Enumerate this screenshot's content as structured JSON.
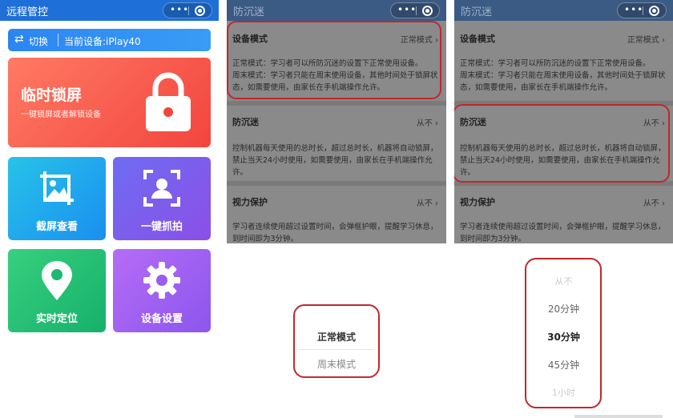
{
  "p1": {
    "title": "远程管控",
    "switch_label": "切换",
    "device": "当前设备:iPlay40",
    "lock": {
      "title": "临时锁屏",
      "subtitle": "一键锁屏或者解锁设备"
    },
    "tiles": [
      "截屏查看",
      "一键抓拍",
      "实时定位",
      "设备设置"
    ]
  },
  "p2": {
    "title": "防沉迷",
    "mode": {
      "title": "设备模式",
      "value": "正常模式",
      "desc1": "正常模式：学习者可以所防沉迷的设置下正常使用设备。",
      "desc2": "周末模式：学习者只能在周末使用设备，其他时间处于锁屏状",
      "desc3": "态，如需要使用，由家长在手机端操作允许。"
    },
    "anti": {
      "title": "防沉迷",
      "value": "从不",
      "desc1": "控制机器每天使用的总时长，超过总时长，机器将自动锁屏，",
      "desc2": "禁止当天24小时使用，如需要使用，由家长在手机端操作允许。"
    },
    "eye": {
      "title": "视力保护",
      "value": "从不",
      "desc1": "学习者连续使用超过设置时间，会弹框护眼，提醒学习休息，",
      "desc2": "到时间即为3分钟。"
    },
    "options": [
      "正常模式",
      "周末模式"
    ]
  },
  "p3": {
    "title": "防沉迷",
    "mode": {
      "title": "设备模式",
      "value": "正常模式",
      "desc1": "正常模式：学习者可以所防沉迷的设置下正常使用设备。",
      "desc2": "周末模式：学习者只能在周末使用设备，其他时间处于锁屏状",
      "desc3": "态，如需要使用，由家长在手机端操作允许。"
    },
    "anti": {
      "title": "防沉迷",
      "value": "从不",
      "desc1": "控制机器每天使用的总时长，超过总时长，机器将自动锁屏，",
      "desc2": "禁止当天24小时使用，如需要使用，由家长在手机端操作允许。"
    },
    "eye": {
      "title": "视力保护",
      "value": "从不",
      "desc1": "学习者连续使用超过设置时间，会弹框护眼，提醒学习休息，",
      "desc2": "到时间即为3分钟。"
    },
    "options": [
      "从不",
      "20分钟",
      "30分钟",
      "45分钟",
      "1小时"
    ]
  },
  "colors": {
    "brand": "#1e6fd8",
    "highlight": "#c0282c"
  }
}
